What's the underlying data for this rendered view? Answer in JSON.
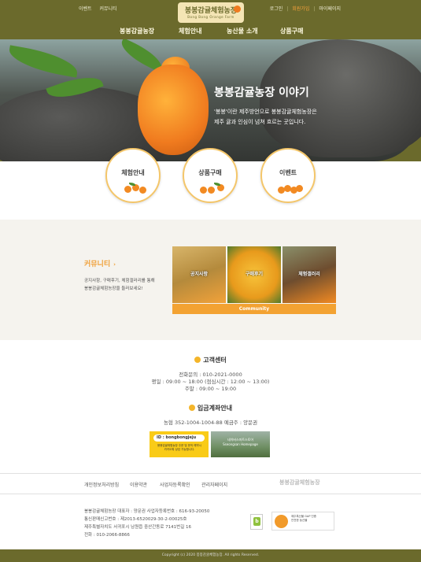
{
  "colors": {
    "olive": "#6b6a2c",
    "accent": "#f3a232",
    "community_bg": "#f5f3ee"
  },
  "topbar": {
    "left_links": [
      "이벤트",
      "커뮤니티"
    ],
    "right_links": [
      "로그인",
      "회원가입",
      "마이페이지"
    ]
  },
  "logo": {
    "main": "봉봉감귤체험농장",
    "sub": "Bong Bong Orange Farm"
  },
  "nav": [
    "봉봉감귤농장",
    "체험안내",
    "농산물 소개",
    "상품구매"
  ],
  "hero": {
    "title": "봉봉감귤농장 이야기",
    "text_line1": "'봉봉'이란 제주방언으로 봉봉감귤체험농장은",
    "text_line2": "제주 귤과 인심이 넘쳐 흐르는 곳입니다."
  },
  "circles": [
    "체험안내",
    "상품구매",
    "이벤트"
  ],
  "community": {
    "title": "커뮤니티",
    "arrow": "›",
    "desc_line1": "공지사항, 구매후기, 체험갤러리를 통해",
    "desc_line2": "봉봉감귤체험농장을 둘러보세요!",
    "photos": [
      "공지사항",
      "구매후기",
      "체험갤러리"
    ],
    "bar": "Community"
  },
  "customer_center": {
    "title": "고객센터",
    "phone": "전화문의 : 010-2021-0000",
    "weekday": "평일 : 09:00 ~ 18:00 (점심시간 : 12:00 ~ 13:00)",
    "weekend": "주말 : 09:00 ~ 19:00"
  },
  "deposit": {
    "title": "입금계좌안내",
    "account": "농협  352-1004-1004-88   예금주 : 양문권"
  },
  "banners": {
    "kakao_id": "ID : bongbongjeju",
    "kakao_line1": "봉봉감귤체험농장 주문 및 문의 예약시",
    "kakao_line2": "카카오톡 상담 가능합니다.",
    "store_line1": "네이버스마트스토어",
    "store_line2": "Sseongsan Homepage"
  },
  "footer": {
    "links": [
      "개인정보처리방침",
      "이용약관",
      "사업자등록확인",
      "관리자페이지"
    ],
    "logo": "봉봉감귤체험농장",
    "info_line1": "봉봉감귤체험농장   대표자 : 양문권   사업자등록번호 : 616-93-20050",
    "info_line2": "통신판매신고번호 : 제2013-6520029-30-2-00025호",
    "info_line3": "제주특별자치도 서귀포시 남원읍 중산간동로 7141번길 16",
    "info_line4": "전화 : 010-2066-8866",
    "cert_line1": "제주특산물 GAP 인증",
    "cert_line2": "안전한 농산물",
    "copyright": "Copyright (c) 2020 봉봉감귤체험농장. All rights Reserved."
  }
}
